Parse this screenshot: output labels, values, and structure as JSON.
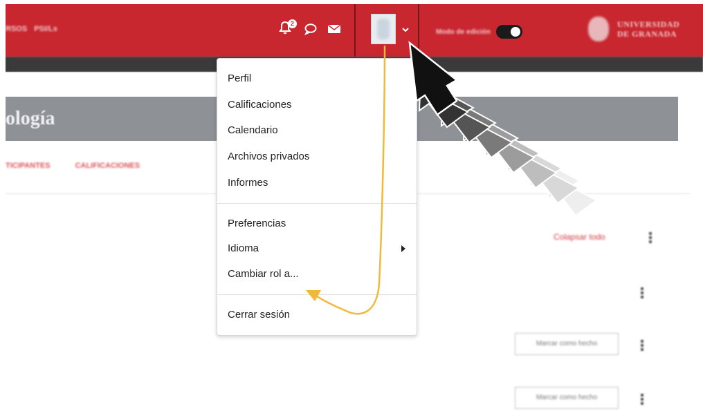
{
  "navbar": {
    "left_links": [
      "RSOS",
      "PSI/Ls"
    ],
    "notification_count": "2",
    "edit_mode_label": "Modo de edición",
    "university_name": [
      "UNIVERSIDAD",
      "DE GRANADA"
    ],
    "background_color": "#c8272f"
  },
  "course": {
    "title": "ología",
    "tabs": [
      "TICIPANTES",
      "CALIFICACIONES"
    ],
    "collapse_all": "Colapsar todo",
    "mark_done_buttons": [
      "Marcar como hecho",
      "Marcar como hecho"
    ]
  },
  "user_menu": {
    "items": [
      "Perfil",
      "Calificaciones",
      "Calendario",
      "Archivos privados",
      "Informes"
    ],
    "settings_items": [
      "Preferencias",
      "Idioma",
      "Cambiar rol a..."
    ],
    "logout": "Cerrar sesión"
  },
  "annotation_colors": {
    "pointer_arrow": "#111111",
    "guide_line": "#f0b93b"
  }
}
